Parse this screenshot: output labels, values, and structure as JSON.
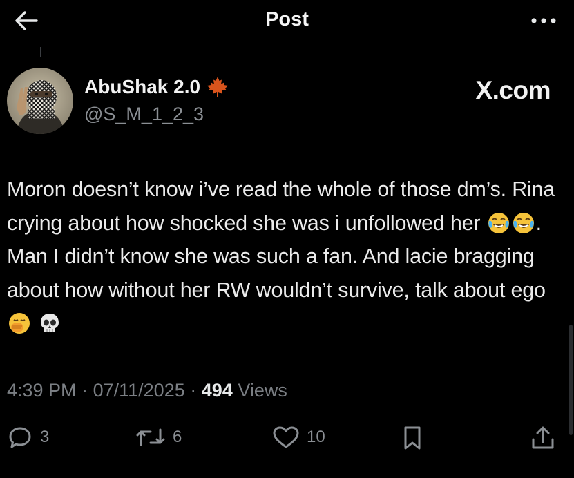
{
  "header": {
    "title": "Post",
    "back_icon": "arrow-left-icon",
    "more_icon": "more-horizontal-icon"
  },
  "author": {
    "display_name": "AbuShak 2.0",
    "handle": "@S_M_1_2_3",
    "badge_icon": "maple-leaf-icon"
  },
  "watermark": "X.com",
  "tweet": {
    "segments": [
      "Moron doesn’t know i’ve read the whole of those dm’s. Rina crying about how shocked she was i unfollowed her ",
      ". Man I didn’t know she was such a fan. And lacie bragging about how without her RW wouldn’t survive, talk about ego "
    ],
    "emojis": [
      "face-with-tears-of-joy-emoji",
      "face-with-tears-of-joy-emoji",
      "face-with-hand-over-mouth-emoji",
      "skull-emoji"
    ]
  },
  "meta": {
    "time": "4:39 PM",
    "date": "07/11/2025",
    "separator": "·",
    "views_count": "494",
    "views_label": "Views"
  },
  "actions": {
    "replies": "3",
    "reposts": "6",
    "likes": "10"
  },
  "colors": {
    "background": "#000000",
    "text_primary": "#e7e9ea",
    "text_secondary": "#8b8f94",
    "badge": "#d9541c"
  }
}
